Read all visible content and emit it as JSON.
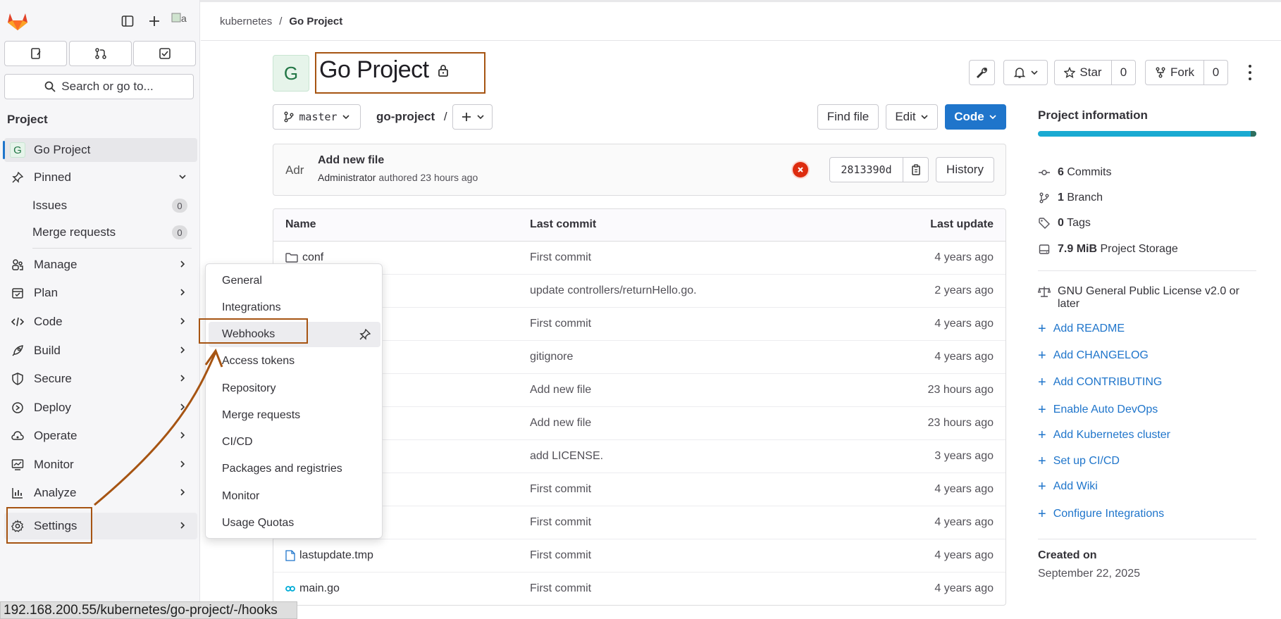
{
  "breadcrumb": [
    "kubernetes",
    "Go Project"
  ],
  "sidebar": {
    "search_label": "Search or go to...",
    "section_title": "Project",
    "project_item": {
      "avatar": "G",
      "label": "Go Project"
    },
    "pinned": {
      "label": "Pinned",
      "items": [
        {
          "label": "Issues",
          "count": "0"
        },
        {
          "label": "Merge requests",
          "count": "0"
        }
      ]
    },
    "menu": [
      "Manage",
      "Plan",
      "Code",
      "Build",
      "Secure",
      "Deploy",
      "Operate",
      "Monitor",
      "Analyze",
      "Settings"
    ]
  },
  "project": {
    "avatar": "G",
    "title": "Go Project"
  },
  "actions": {
    "star_label": "Star",
    "star_count": "0",
    "fork_label": "Fork",
    "fork_count": "0"
  },
  "repo_bar": {
    "branch": "master",
    "path": "go-project",
    "path_sep": "/",
    "find_file": "Find file",
    "edit": "Edit",
    "code": "Code"
  },
  "last_commit": {
    "avatar_text": "Adr",
    "title": "Add new file",
    "author": "Administrator",
    "meta": "authored 23 hours ago",
    "sha": "2813390d",
    "history": "History"
  },
  "files": {
    "headers": {
      "name": "Name",
      "commit": "Last commit",
      "update": "Last update"
    },
    "rows": [
      {
        "name": "conf",
        "commit": "First commit",
        "update": "4 years ago"
      },
      {
        "name": "",
        "commit": "update controllers/returnHello.go.",
        "update": "2 years ago"
      },
      {
        "name": "",
        "commit": "First commit",
        "update": "4 years ago"
      },
      {
        "name": "",
        "commit": "gitignore",
        "update": "4 years ago"
      },
      {
        "name": "",
        "commit": "Add new file",
        "update": "23 hours ago"
      },
      {
        "name": "",
        "commit": "Add new file",
        "update": "23 hours ago"
      },
      {
        "name": "",
        "commit": "add LICENSE.",
        "update": "3 years ago"
      },
      {
        "name": "",
        "commit": "First commit",
        "update": "4 years ago"
      },
      {
        "name": "",
        "commit": "First commit",
        "update": "4 years ago"
      },
      {
        "name": "lastupdate.tmp",
        "commit": "First commit",
        "update": "4 years ago"
      },
      {
        "name": "main.go",
        "commit": "First commit",
        "update": "4 years ago"
      }
    ]
  },
  "project_info": {
    "title": "Project information",
    "commits": {
      "count": "6",
      "label": "Commits"
    },
    "branches": {
      "count": "1",
      "label": "Branch"
    },
    "tags": {
      "count": "0",
      "label": "Tags"
    },
    "storage": {
      "count": "7.9 MiB",
      "label": "Project Storage"
    },
    "license": "GNU General Public License v2.0 or later",
    "links": [
      "Add README",
      "Add CHANGELOG",
      "Add CONTRIBUTING",
      "Enable Auto DevOps",
      "Add Kubernetes cluster",
      "Set up CI/CD",
      "Add Wiki",
      "Configure Integrations"
    ],
    "created_label": "Created on",
    "created_date": "September 22, 2025"
  },
  "settings_flyout": [
    "General",
    "Integrations",
    "Webhooks",
    "Access tokens",
    "Repository",
    "Merge requests",
    "CI/CD",
    "Packages and registries",
    "Monitor",
    "Usage Quotas"
  ],
  "status_url": "192.168.200.55/kubernetes/go-project/-/hooks",
  "colors": {
    "accent": "#1f75cb",
    "annotation": "#a65412",
    "storage_bar": "#1aaad2"
  }
}
